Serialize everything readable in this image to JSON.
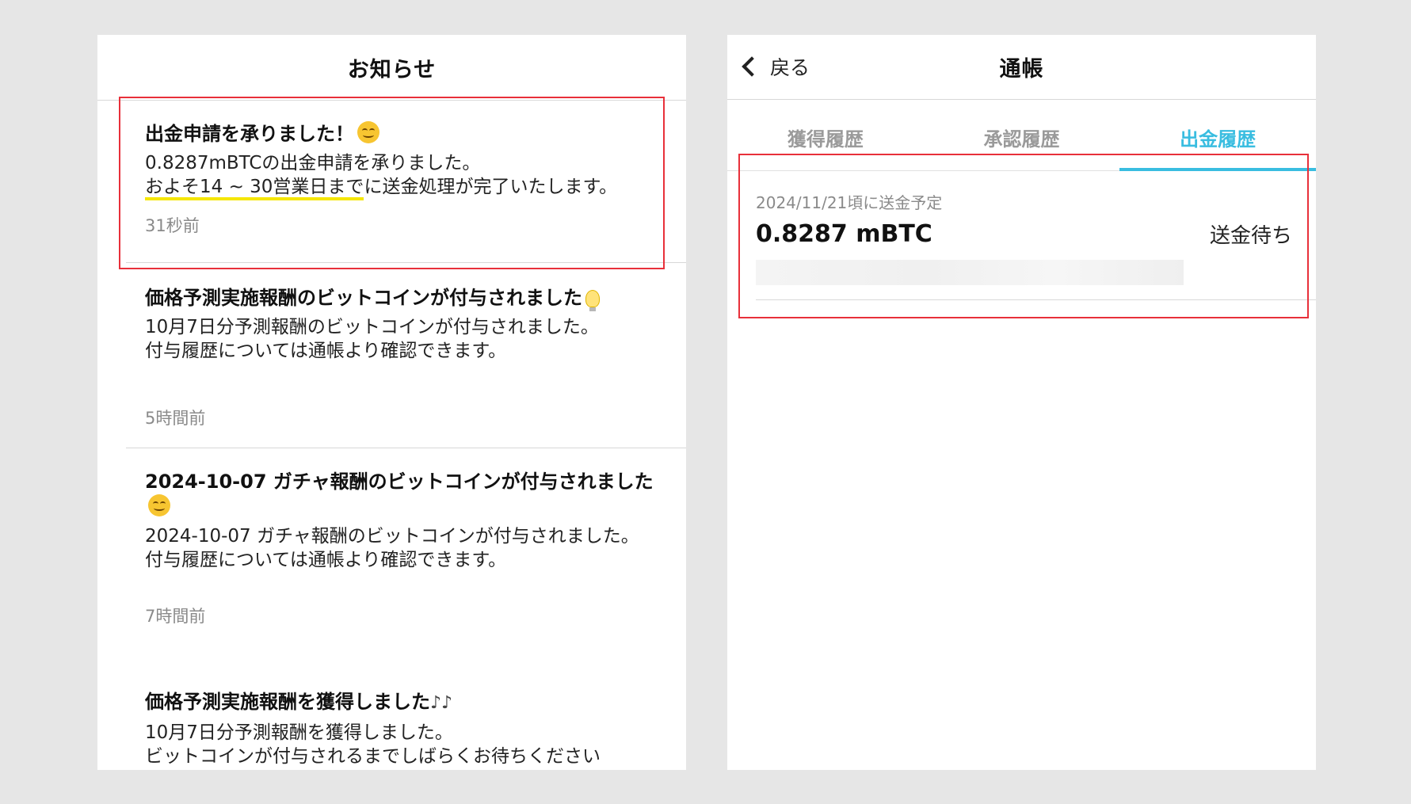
{
  "left": {
    "title": "お知らせ",
    "notices": [
      {
        "title": "出金申請を承りました！",
        "body1": "0.8287mBTCの出金申請を承りました。",
        "body2_highlight": "およそ14 ~ 30営業日まで",
        "body2_rest": "に送金処理が完了いたします。",
        "time": "31秒前"
      },
      {
        "title": "価格予測実施報酬のビットコインが付与されました",
        "body1": "10月7日分予測報酬のビットコインが付与されました。",
        "body2": "付与履歴については通帳より確認できます。",
        "time": "5時間前"
      },
      {
        "title": "2024-10-07 ガチャ報酬のビットコインが付与されました",
        "body1": "2024-10-07 ガチャ報酬のビットコインが付与されました。",
        "body2": "付与履歴については通帳より確認できます。",
        "time": "7時間前"
      },
      {
        "title": "価格予測実施報酬を獲得しました",
        "title_suffix": "♪♪",
        "body1": "10月7日分予測報酬を獲得しました。",
        "body2": "ビットコインが付与されるまでしばらくお待ちください"
      }
    ]
  },
  "right": {
    "back_label": "戻る",
    "title": "通帳",
    "tabs": [
      "獲得履歴",
      "承認履歴",
      "出金履歴"
    ],
    "active_tab": 2,
    "history": {
      "date": "2024/11/21頃に送金予定",
      "amount": "0.8287 mBTC",
      "status": "送金待ち"
    }
  },
  "colors": {
    "accent": "#39bde0",
    "highlight_box": "#e8303a",
    "underline": "#f5e600"
  }
}
